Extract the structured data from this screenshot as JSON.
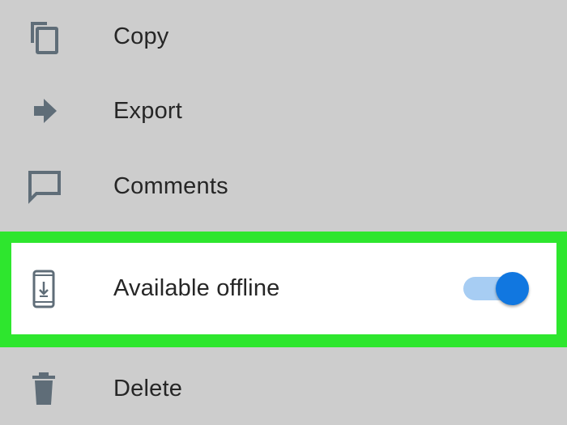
{
  "menu": {
    "items": [
      {
        "label": "Copy",
        "icon": "copy-icon"
      },
      {
        "label": "Export",
        "icon": "export-arrow-icon"
      },
      {
        "label": "Comments",
        "icon": "comment-icon"
      },
      {
        "label": "Available offline",
        "icon": "phone-download-icon",
        "toggle_on": true
      },
      {
        "label": "Delete",
        "icon": "trash-icon"
      }
    ]
  },
  "colors": {
    "background": "#cdcdcd",
    "highlight_border": "#2ee62e",
    "icon": "#5f6d78",
    "toggle_thumb": "#1177e0",
    "toggle_track": "#a7cdf3"
  }
}
